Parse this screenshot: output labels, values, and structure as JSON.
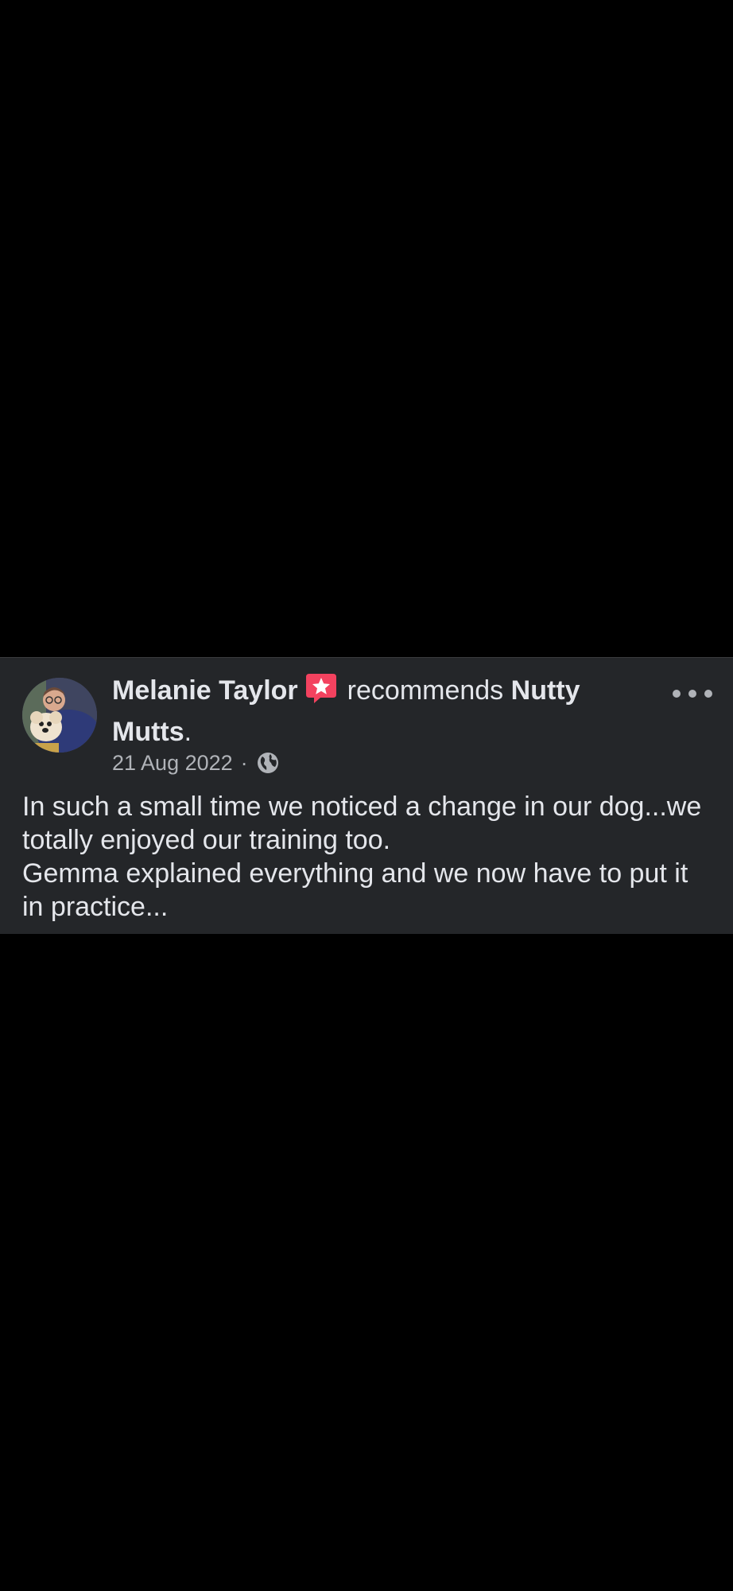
{
  "post": {
    "author": "Melanie Taylor",
    "action": "recommends",
    "page": "Nutty Mutts",
    "period": ".",
    "date": "21 Aug 2022",
    "separator": "·",
    "privacy_icon": "globe-icon",
    "badge_icon": "recommendation-star-icon",
    "more_icon": "more-options-icon",
    "body_lines": [
      "In such a small time we noticed a change in our dog...we totally enjoyed our training too.",
      "Gemma explained everything and we now have to put it in practice..."
    ]
  },
  "colors": {
    "page_background": "#000000",
    "card_background": "#242629",
    "primary_text": "#e4e6eb",
    "secondary_text": "#b0b3b8",
    "badge_red": "#f3425f"
  }
}
